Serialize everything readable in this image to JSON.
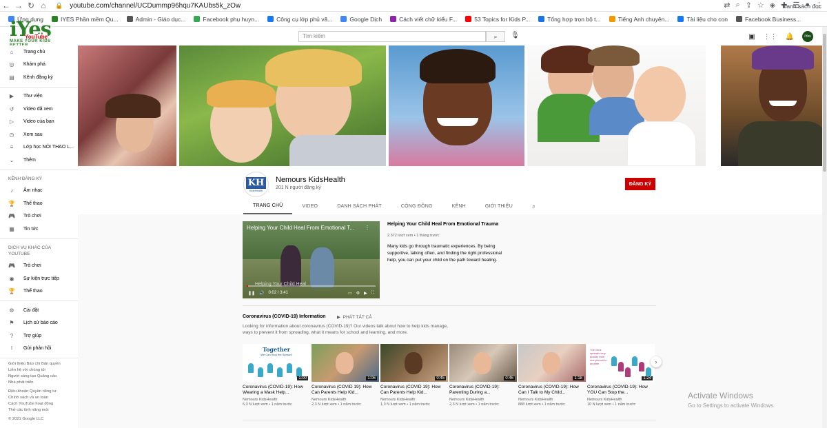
{
  "browser": {
    "url": "youtube.com/channel/UCDummp96hqu7KAUbs5k_zOw",
    "bookmarks": [
      {
        "label": "Ứng dụng",
        "color": "#4285f4"
      },
      {
        "label": "IYES Phần mềm Qu...",
        "color": "#2d7f2a"
      },
      {
        "label": "Admin - Giáo dục...",
        "color": "#555555"
      },
      {
        "label": "Facebook phụ huyn...",
        "color": "#34a853"
      },
      {
        "label": "Công cụ lớp phủ vă...",
        "color": "#1877f2"
      },
      {
        "label": "Google Dịch",
        "color": "#4285f4"
      },
      {
        "label": "Cách viết chữ kiểu F...",
        "color": "#8e24aa"
      },
      {
        "label": "53 Topics for Kids P...",
        "color": "#ff0000"
      },
      {
        "label": "Tổng hợp trọn bộ t...",
        "color": "#1a73e8"
      },
      {
        "label": "Tiếng Anh chuyên...",
        "color": "#f29900"
      },
      {
        "label": "Tài liệu cho con",
        "color": "#1877f2"
      },
      {
        "label": "Facebook Business...",
        "color": "#555555"
      }
    ],
    "bookmarks_other": "Danh sách đọc"
  },
  "logo": {
    "big": "iYes",
    "yt": "YouTube",
    "tag": "MAKE YOUR KIDS BETTER"
  },
  "search": {
    "placeholder": "Tìm kiếm"
  },
  "sidebar": {
    "main": [
      {
        "icon": "⌂",
        "label": "Trang chủ"
      },
      {
        "icon": "◎",
        "label": "Khám phá"
      },
      {
        "icon": "▤",
        "label": "Kênh đăng ký"
      }
    ],
    "library": [
      {
        "icon": "▶",
        "label": "Thư viện"
      },
      {
        "icon": "↺",
        "label": "Video đã xem"
      },
      {
        "icon": "▷",
        "label": "Video của bạn"
      },
      {
        "icon": "◷",
        "label": "Xem sau"
      },
      {
        "icon": "≡",
        "label": "Lớp học NÓI THAO L..."
      },
      {
        "icon": "⌄",
        "label": "Thêm"
      }
    ],
    "subs_heading": "KÊNH ĐĂNG KÝ",
    "subs": [
      {
        "icon": "♪",
        "label": "Âm nhạc"
      },
      {
        "icon": "🏆",
        "label": "Thể thao"
      },
      {
        "icon": "🎮",
        "label": "Trò chơi"
      },
      {
        "icon": "▦",
        "label": "Tin tức"
      }
    ],
    "more_heading": "DỊCH VỤ KHÁC CỦA YOUTUBE",
    "more": [
      {
        "icon": "🎮",
        "label": "Trò chơi"
      },
      {
        "icon": "◉",
        "label": "Sự kiện trực tiếp"
      },
      {
        "icon": "🏆",
        "label": "Thể thao"
      }
    ],
    "settings": [
      {
        "icon": "⚙",
        "label": "Cài đặt"
      },
      {
        "icon": "⚑",
        "label": "Lịch sử báo cáo"
      },
      {
        "icon": "?",
        "label": "Trợ giúp"
      },
      {
        "icon": "!",
        "label": "Gửi phản hồi"
      }
    ],
    "footer1": "Giới thiệu  Báo chí  Bản quyền",
    "footer2": "Liên hệ với chúng tôi",
    "footer3": "Người sáng tạo  Quảng cáo",
    "footer4": "Nhà phát triển",
    "footer5": "Điều khoản  Quyền riêng tư",
    "footer6": "Chính sách và an toàn",
    "footer7": "Cách YouTube hoạt động",
    "footer8": "Thử các tính năng mới",
    "copyright": "© 2021 Google LLC"
  },
  "channel": {
    "avatar_text": "KH",
    "avatar_sub": "KidsHealth",
    "name": "Nemours KidsHealth",
    "subs": "201 N người đăng ký",
    "subscribe": "ĐĂNG KÝ",
    "tabs": [
      "TRANG CHỦ",
      "VIDEO",
      "DANH SÁCH PHÁT",
      "CỘNG ĐỒNG",
      "KÊNH",
      "GIỚI THIỆU"
    ]
  },
  "featured": {
    "overlay_title": "Helping Your Child Heal From Emotional T...",
    "overlay_caption": "Helping Your Child Heal",
    "time": "0:02 / 3:41",
    "progress": 0.01,
    "title": "Helping Your Child Heal From Emotional Trauma",
    "meta": "2.372 lượt xem • 1 tháng trước",
    "desc": "Many kids go through traumatic experiences. By being supportive, talking often, and finding the right professional help, you can put your child on the path toward healing."
  },
  "playlist": {
    "title": "Coronavirus (COVID-19) Information",
    "play_all": "PHÁT TẤT CẢ",
    "desc": "Looking for information about coronavirus (COVID-19)? Our videos talk about how to help kids manage, ways to prevent it from spreading, what it means for school and learning, and more."
  },
  "videos": [
    {
      "thumb_text": "Together",
      "thumb_sub": "We Can Stop the Spread!",
      "duration": "1:00",
      "title": "Coronavirus (COVID-19): How Wearing a Mask Help...",
      "channel": "Nemours KidsHealth",
      "meta": "6,3 N lượt xem • 1 năm trước"
    },
    {
      "thumb_text": "",
      "thumb_sub": "",
      "duration": "1:06",
      "title": "Coronavirus (COVID 19): How Can Parents Help Kid...",
      "channel": "Nemours KidsHealth",
      "meta": "2,3 N lượt xem • 1 năm trước"
    },
    {
      "thumb_text": "",
      "thumb_sub": "",
      "duration": "0:45",
      "title": "Coronavirus (COVID 19): How Can Parents Help Kid...",
      "channel": "Nemours KidsHealth",
      "meta": "1,3 N lượt xem • 1 năm trước"
    },
    {
      "thumb_text": "",
      "thumb_sub": "",
      "duration": "0:46",
      "title": "Coronavirus (COVID-19): Parenting During a...",
      "channel": "Nemours KidsHealth",
      "meta": "2,3 N lượt xem • 1 năm trước"
    },
    {
      "thumb_text": "",
      "thumb_sub": "",
      "duration": "1:18",
      "title": "Coronavirus (COVID-19): How Can I Talk to My Child...",
      "channel": "Nemours KidsHealth",
      "meta": "888 lượt xem • 1 năm trước"
    },
    {
      "thumb_text": "The virus spreads very quickly from one person to another",
      "thumb_sub": "",
      "duration": "1:24",
      "title": "Coronavirus (COVID-19): How YOU Can Stop the...",
      "channel": "Nemours KidsHealth",
      "meta": "10 N lượt xem • 1 năm trước"
    }
  ],
  "watermark": {
    "line1": "Activate Windows",
    "line2": "Go to Settings to activate Windows."
  }
}
